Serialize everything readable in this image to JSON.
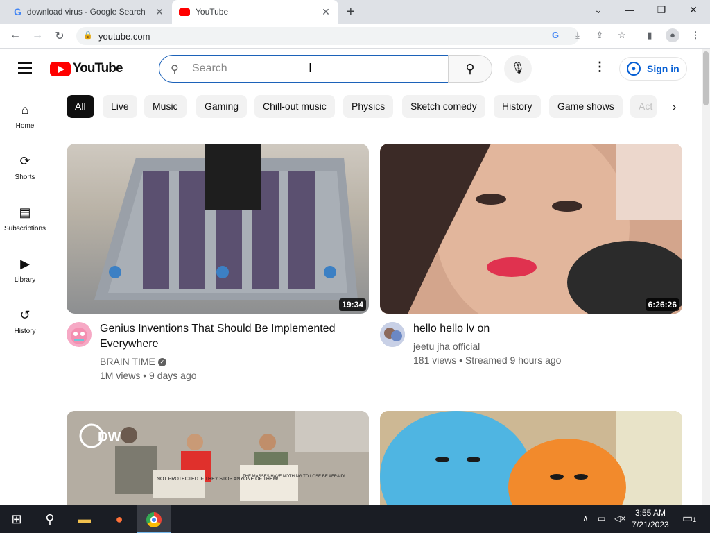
{
  "browser": {
    "tabs": [
      {
        "title": "download virus - Google Search",
        "active": false,
        "icon": "google-g-icon"
      },
      {
        "title": "YouTube",
        "active": true,
        "icon": "youtube-icon"
      }
    ],
    "new_tab": "+",
    "url": "youtube.com"
  },
  "youtube": {
    "logo_text": "YouTube",
    "search_placeholder": "Search",
    "signin_label": "Sign in",
    "sidebar": [
      {
        "label": "Home",
        "icon": "home-icon"
      },
      {
        "label": "Shorts",
        "icon": "shorts-icon"
      },
      {
        "label": "Subscriptions",
        "icon": "subscriptions-icon"
      },
      {
        "label": "Library",
        "icon": "library-icon"
      },
      {
        "label": "History",
        "icon": "history-icon"
      }
    ],
    "chips": [
      "All",
      "Live",
      "Music",
      "Gaming",
      "Chill-out music",
      "Physics",
      "Sketch comedy",
      "History",
      "Game shows",
      "Act"
    ],
    "videos": [
      {
        "title": "Genius Inventions That Should Be Implemented Everywhere",
        "channel": "BRAIN TIME",
        "verified": true,
        "stats": "1M views • 9 days ago",
        "duration": "19:34"
      },
      {
        "title": "hello hello lv on",
        "channel": "jeetu jha official",
        "verified": false,
        "stats": "181 views • Streamed 9 hours ago",
        "duration": "6:26:26"
      },
      {
        "title": "",
        "channel": "",
        "stats": "",
        "duration": ""
      },
      {
        "title": "",
        "channel": "",
        "stats": "",
        "duration": ""
      }
    ],
    "thumb_texts": {
      "dw_logo": "DW",
      "sign1": "NOT PROTECTED IF THEY STOP ANYONE OF THEM!",
      "sign2": "THE MASSES HAVE NOTHING TO LOSE BE AFRAID!"
    }
  },
  "taskbar": {
    "time": "3:55 AM",
    "date": "7/21/2023",
    "notification_count": "1"
  },
  "colors": {
    "youtube_red": "#ff0000",
    "link_blue": "#065fd4",
    "taskbar": "#1a1d24"
  }
}
